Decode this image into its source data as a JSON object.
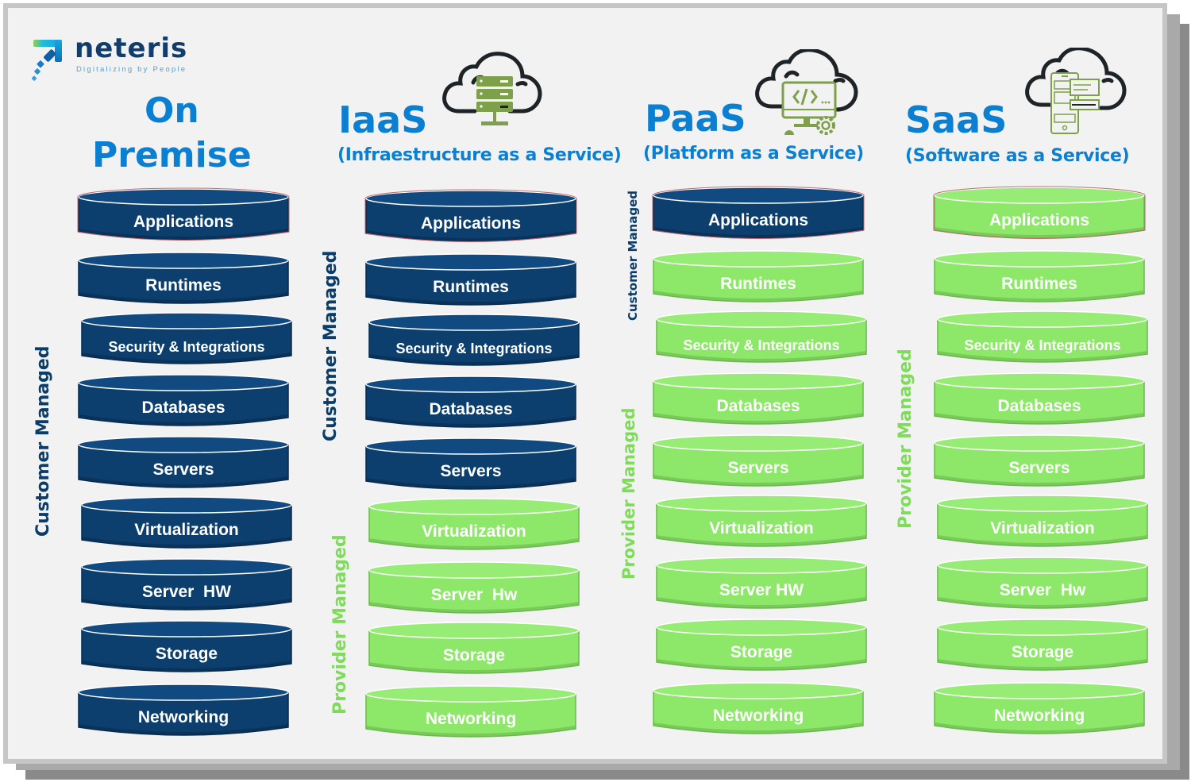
{
  "brand": {
    "name": "neteris",
    "tagline": "Digitalizing by People",
    "colors": {
      "navy": "#0f3d6e",
      "accent_blue": "#0b7fd1",
      "customer": "#0a3d6a",
      "provider": "#8de86a",
      "icon_green": "#7ea04a"
    }
  },
  "columns": [
    {
      "id": "on-premise",
      "title_line1": "On",
      "title_line2": "Premise",
      "subtitle": "",
      "icon": "none",
      "labels": {
        "customer": "Customer Managed",
        "provider": ""
      },
      "layers": [
        {
          "label": "Applications",
          "managed": "customer"
        },
        {
          "label": "Runtimes",
          "managed": "customer"
        },
        {
          "label": "Security & Integrations",
          "managed": "customer"
        },
        {
          "label": "Databases",
          "managed": "customer"
        },
        {
          "label": "Servers",
          "managed": "customer"
        },
        {
          "label": "Virtualization",
          "managed": "customer"
        },
        {
          "label": "Server  HW",
          "managed": "customer"
        },
        {
          "label": "Storage",
          "managed": "customer"
        },
        {
          "label": "Networking",
          "managed": "customer"
        }
      ]
    },
    {
      "id": "iaas",
      "title_line1": "IaaS",
      "subtitle": "(Infraestructure as a Service)",
      "icon": "cloud-server-icon",
      "labels": {
        "customer": "Customer Managed",
        "provider": "Provider Managed"
      },
      "layers": [
        {
          "label": "Applications",
          "managed": "customer"
        },
        {
          "label": "Runtimes",
          "managed": "customer"
        },
        {
          "label": "Security & Integrations",
          "managed": "customer"
        },
        {
          "label": "Databases",
          "managed": "customer"
        },
        {
          "label": "Servers",
          "managed": "customer"
        },
        {
          "label": "Virtualization",
          "managed": "provider"
        },
        {
          "label": "Server  Hw",
          "managed": "provider"
        },
        {
          "label": "Storage",
          "managed": "provider"
        },
        {
          "label": "Networking",
          "managed": "provider"
        }
      ]
    },
    {
      "id": "paas",
      "title_line1": "PaaS",
      "subtitle": "(Platform as a Service)",
      "icon": "cloud-code-icon",
      "labels": {
        "customer": "Customer Managed",
        "provider": "Provider Managed"
      },
      "layers": [
        {
          "label": "Applications",
          "managed": "customer"
        },
        {
          "label": "Runtimes",
          "managed": "provider"
        },
        {
          "label": "Security & Integrations",
          "managed": "provider"
        },
        {
          "label": "Databases",
          "managed": "provider"
        },
        {
          "label": "Servers",
          "managed": "provider"
        },
        {
          "label": "Virtualization",
          "managed": "provider"
        },
        {
          "label": "Server HW",
          "managed": "provider"
        },
        {
          "label": "Storage",
          "managed": "provider"
        },
        {
          "label": "Networking",
          "managed": "provider"
        }
      ]
    },
    {
      "id": "saas",
      "title_line1": "SaaS",
      "subtitle": "(Software as a Service)",
      "icon": "cloud-app-icon",
      "labels": {
        "customer": "",
        "provider": "Provider Managed"
      },
      "layers": [
        {
          "label": "Applications",
          "managed": "provider"
        },
        {
          "label": "Runtimes",
          "managed": "provider"
        },
        {
          "label": "Security & Integrations",
          "managed": "provider"
        },
        {
          "label": "Databases",
          "managed": "provider"
        },
        {
          "label": "Servers",
          "managed": "provider"
        },
        {
          "label": "Virtualization",
          "managed": "provider"
        },
        {
          "label": "Server  Hw",
          "managed": "provider"
        },
        {
          "label": "Storage",
          "managed": "provider"
        },
        {
          "label": "Networking",
          "managed": "provider"
        }
      ]
    }
  ]
}
